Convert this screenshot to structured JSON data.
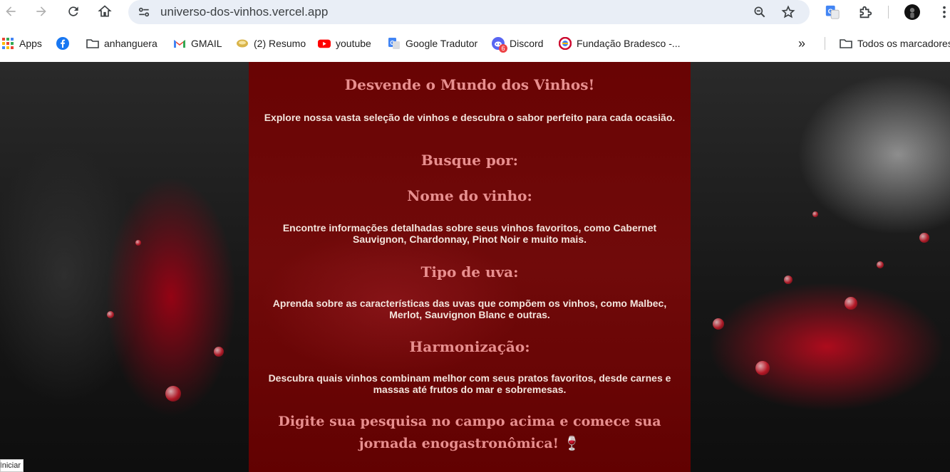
{
  "browser": {
    "url": "universo-dos-vinhos.vercel.app",
    "bookmarks": [
      {
        "label": "Apps",
        "icon": "apps-grid-icon"
      },
      {
        "label": "",
        "icon": "facebook-icon"
      },
      {
        "label": "anhanguera",
        "icon": "folder-icon"
      },
      {
        "label": "GMAIL",
        "icon": "gmail-icon"
      },
      {
        "label": "(2) Resumo",
        "icon": "resumo-favicon-icon"
      },
      {
        "label": "youtube",
        "icon": "youtube-icon"
      },
      {
        "label": "Google Tradutor",
        "icon": "google-translate-icon"
      },
      {
        "label": "Discord",
        "icon": "discord-icon"
      },
      {
        "label": "Fundação Bradesco -...",
        "icon": "bradesco-icon"
      }
    ],
    "more_bookmarks": "»",
    "all_bookmarks": "Todos os marcadores",
    "discord_badge": "6"
  },
  "page": {
    "title": "Desvende o Mundo dos Vinhos!",
    "intro": "Explore nossa vasta seleção de vinhos e descubra o sabor perfeito para cada ocasião.",
    "search_heading": "Busque por:",
    "sections": [
      {
        "heading": "Nome do vinho:",
        "text": "Encontre informações detalhadas sobre seus vinhos favoritos, como Cabernet Sauvignon, Chardonnay, Pinot Noir e muito mais."
      },
      {
        "heading": "Tipo de uva:",
        "text": "Aprenda sobre as características das uvas que compõem os vinhos, como Malbec, Merlot, Sauvignon Blanc e outras."
      },
      {
        "heading": "Harmonização:",
        "text": "Descubra quais vinhos combinam melhor com seus pratos favoritos, desde carnes e massas até frutos do mar e sobremesas."
      }
    ],
    "cta": "Digite sua pesquisa no campo acima e comece sua jornada enogastronômica! 🍷"
  },
  "status_chip": "Iniciar",
  "colors": {
    "heading": "#e88f8f",
    "panel": "#7a0000",
    "body_text": "#f3e4dc"
  }
}
